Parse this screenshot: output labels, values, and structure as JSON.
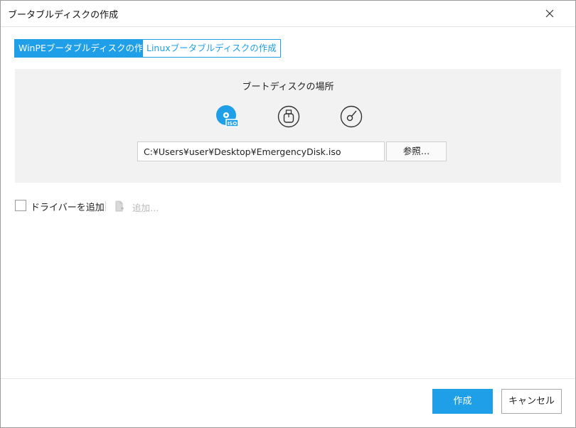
{
  "window": {
    "title": "ブータブルディスクの作成"
  },
  "tabs": [
    {
      "label": "WinPEブータブルディスクの作成",
      "active": true
    },
    {
      "label": "Linuxブータブルディスクの作成",
      "active": false
    }
  ],
  "panel": {
    "title": "ブートディスクの場所",
    "media_options": [
      {
        "icon": "iso-disc-icon",
        "badge": "ISO",
        "selected": true
      },
      {
        "icon": "usb-drive-icon",
        "selected": false
      },
      {
        "icon": "cd-dvd-icon",
        "selected": false
      }
    ],
    "path_value": "C:¥Users¥user¥Desktop¥EmergencyDisk.iso",
    "browse_label": "参照…"
  },
  "driver": {
    "checkbox_label": "ドライバーを追加",
    "checked": false,
    "add_label": "追加…"
  },
  "footer": {
    "create_label": "作成",
    "cancel_label": "キャンセル"
  },
  "colors": {
    "accent": "#1e9fe8",
    "panel_bg": "#f2f2f2",
    "disabled_text": "#b8b8b8"
  }
}
